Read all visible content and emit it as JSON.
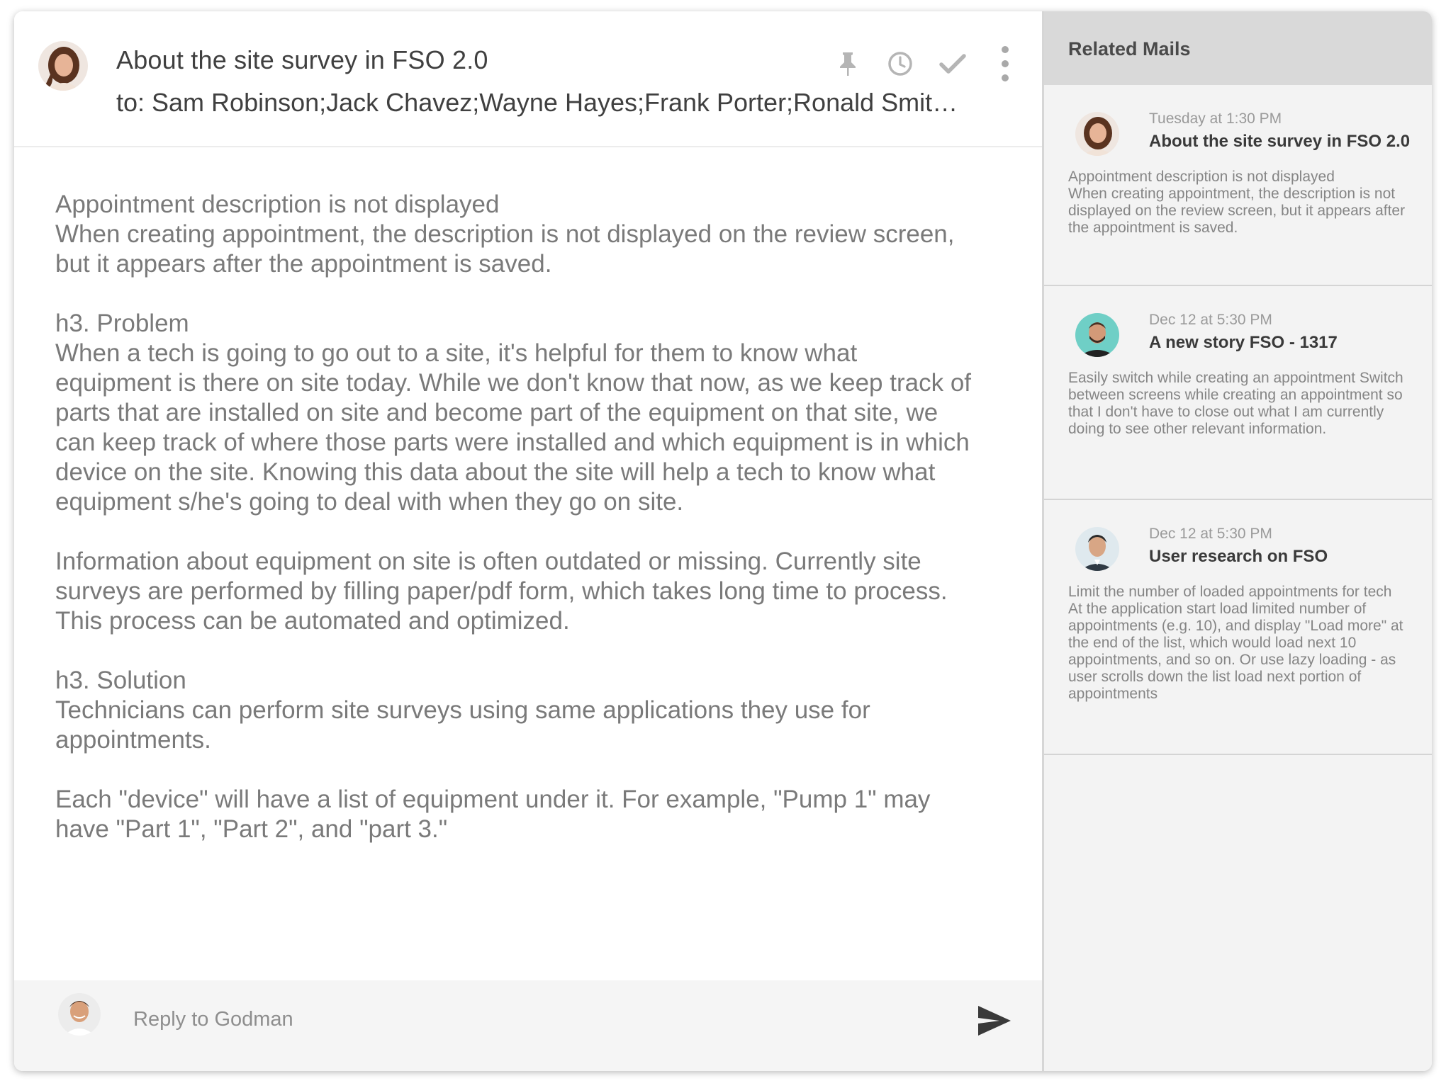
{
  "mail": {
    "subject": "About the site survey in FSO 2.0",
    "recipients": "to: Sam Robinson;Jack Chavez;Wayne Hayes;Frank Porter;Ronald Smith;Harold Scott",
    "toolbar": {
      "pin_icon": "pin-icon",
      "snooze_icon": "clock-icon",
      "done_icon": "checkmark-icon",
      "more_icon": "more-vertical-icon"
    },
    "body": {
      "p1": "Appointment description is not displayed\nWhen creating appointment, the description is not displayed on the review screen, but it appears after the appointment is saved.",
      "p2": "h3. Problem\nWhen a tech is going to go out to a site, it's helpful for them to know what equipment is there on site today.  While we don't know that now, as we keep track of parts that are installed on site and become part of the equipment on that site, we can keep track of where those parts were installed and which equipment is in which device on the site.  Knowing this data about the site will help a tech to know what equipment s/he's going to deal with when they go on site.",
      "p3": "Information about equipment on site is often outdated or missing. Currently site surveys are performed by filling paper/pdf form, which takes long time to process. This process can be automated and optimized.",
      "p4": "h3. Solution\nTechnicians can perform site surveys using same applications they use for appointments.",
      "p5": "Each \"device\" will have a list of equipment under it.  For example, \"Pump 1\" may have \"Part 1\", \"Part 2\", and \"part 3.\""
    }
  },
  "reply": {
    "placeholder": "Reply to Godman",
    "send_icon": "send-icon"
  },
  "sidebar": {
    "title": "Related Mails",
    "items": [
      {
        "date": "Tuesday at 1:30 PM",
        "title": "About the site survey in FSO 2.0",
        "snippet": "Appointment description is not displayed\nWhen creating appointment, the description is not displayed on the review screen, but it appears after the appointment is saved."
      },
      {
        "date": "Dec 12 at 5:30 PM",
        "title": "A new story FSO - 1317",
        "snippet": "Easily switch while creating an appointment Switch between screens while creating an appointment so that I don't have to close out what I am currently doing to see other relevant information."
      },
      {
        "date": "Dec 12 at 5:30 PM",
        "title": "User research on FSO",
        "snippet": "Limit the number of loaded appointments for tech At the application start load limited number of appointments (e.g. 10), and display \"Load more\" at the end of the list, which would load next 10 appointments, and so on. Or use lazy loading - as user scrolls down the list load next portion of appointments"
      }
    ]
  },
  "colors": {
    "text_primary": "#404040",
    "text_body": "#7a7a7a",
    "sidebar_bg": "#f3f3f3",
    "sidebar_header_bg": "#d9d9d9",
    "icon_gray": "#b5b5b5"
  }
}
